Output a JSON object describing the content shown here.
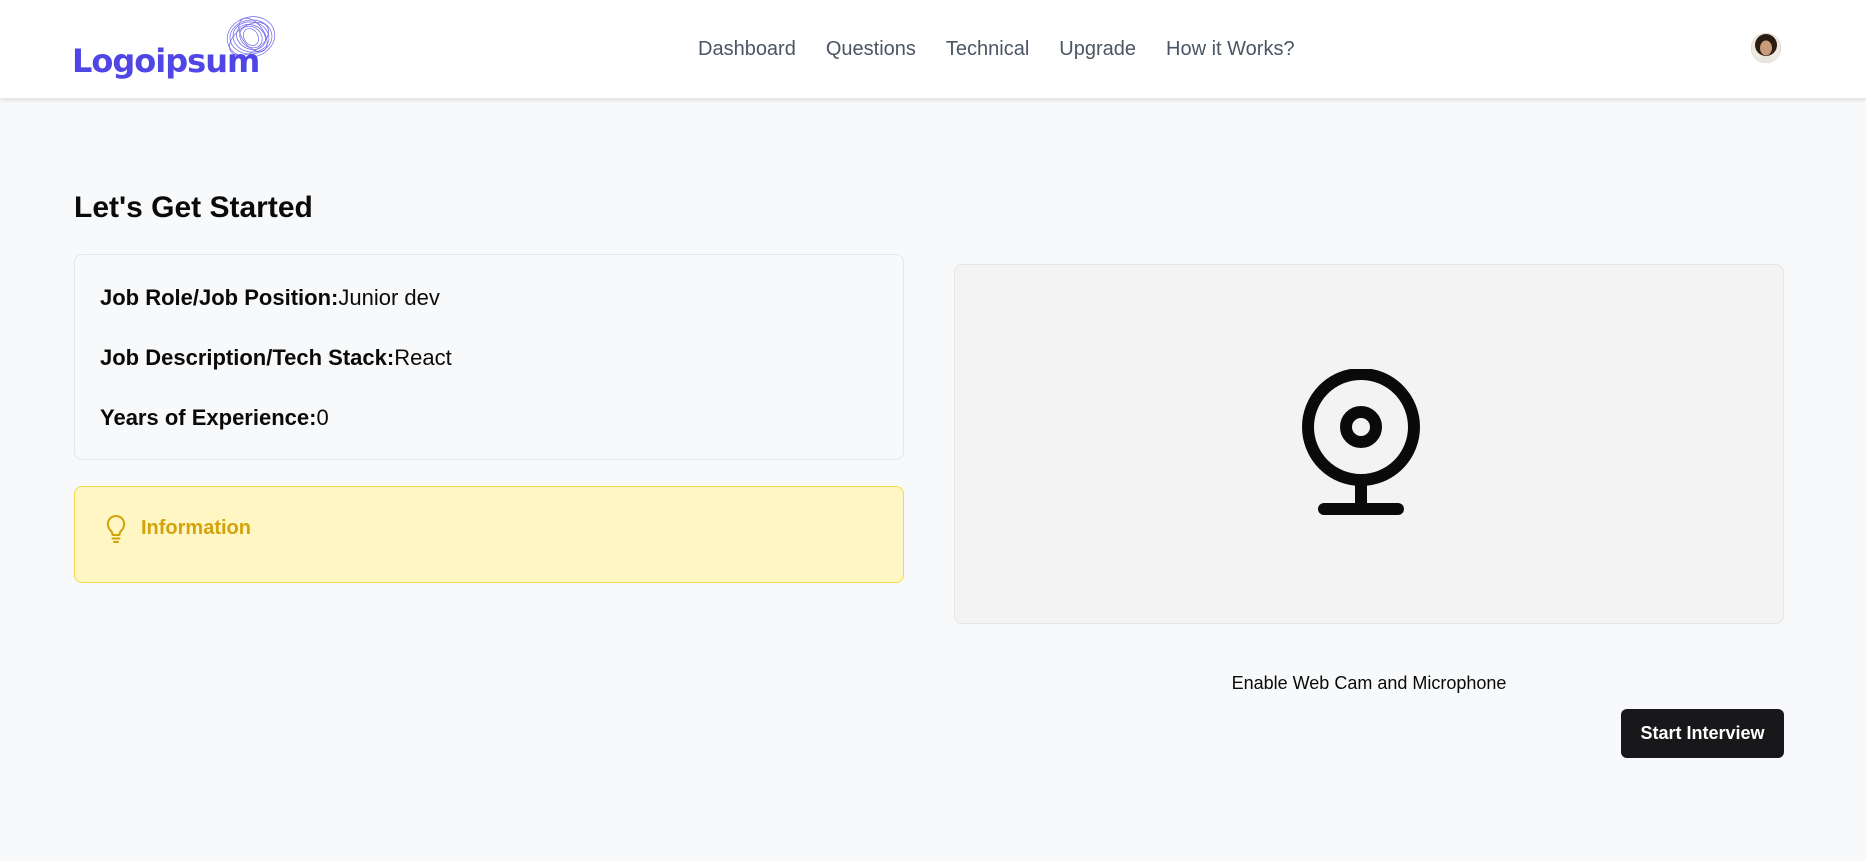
{
  "logo": {
    "text": "Logoipsum"
  },
  "nav": {
    "items": [
      {
        "label": "Dashboard"
      },
      {
        "label": "Questions"
      },
      {
        "label": "Technical"
      },
      {
        "label": "Upgrade"
      },
      {
        "label": "How it Works?"
      }
    ]
  },
  "user": {
    "avatar_icon": "user-avatar"
  },
  "page": {
    "title": "Let's Get Started"
  },
  "job": {
    "role_label": "Job Role/Job Position:",
    "role_value": "Junior dev",
    "desc_label": "Job Description/Tech Stack:",
    "desc_value": "React",
    "exp_label": "Years of Experience:",
    "exp_value": "0"
  },
  "info": {
    "title": "Information",
    "icon": "lightbulb-icon"
  },
  "webcam": {
    "icon": "webcam-icon",
    "enable_label": "Enable Web Cam and Microphone"
  },
  "actions": {
    "start_label": "Start Interview"
  },
  "colors": {
    "brand": "#4f46e5",
    "alert_bg": "#fef7c3",
    "alert_text": "#d4a20a",
    "button_bg": "#18181b"
  }
}
